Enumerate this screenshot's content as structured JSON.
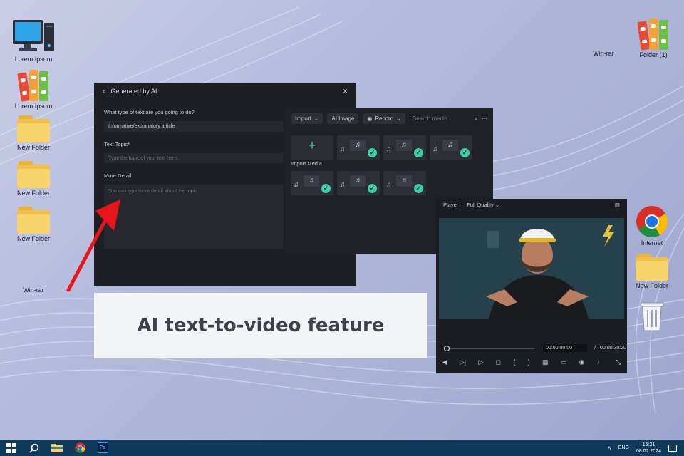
{
  "desktop": {
    "left_icons": [
      {
        "label": "Lorem Ipsum"
      },
      {
        "label": "Lorem Ipsum"
      },
      {
        "label": "New Folder"
      },
      {
        "label": "New Folder"
      },
      {
        "label": "New Folder"
      },
      {
        "label": "Win-rar"
      }
    ],
    "top_right_icons": [
      {
        "label": "Win-rar"
      },
      {
        "label": "Folder (1)"
      }
    ],
    "right_icons": [
      {
        "label": "Internet"
      },
      {
        "label": "New Folder"
      }
    ]
  },
  "ai_window": {
    "title": "Generated by AI",
    "question": "What type of text are you going to do?",
    "type_value": "Informative/explanatory article",
    "topic_label": "Text Topic*",
    "topic_placeholder": "Type the topic of your text here.",
    "detail_label": "More Detail",
    "detail_placeholder": "You can type more detail about the topic."
  },
  "media_panel": {
    "import_label": "Import",
    "ai_image_label": "AI Image",
    "record_label": "Record",
    "search_placeholder": "Search media",
    "import_media_label": "Import Media"
  },
  "player": {
    "title": "Player",
    "quality": "Full Quality",
    "current_time": "00:00:00:00",
    "separator": "/",
    "total_time": "00:00:30:20"
  },
  "caption": {
    "text": "AI text-to-video feature"
  },
  "taskbar": {
    "language": "ENG",
    "time": "15:21",
    "date": "08.02.2024"
  },
  "colors": {
    "accent_teal": "#3fd0a9",
    "arrow_red": "#e8161b",
    "taskbar": "#0f3a5a"
  }
}
